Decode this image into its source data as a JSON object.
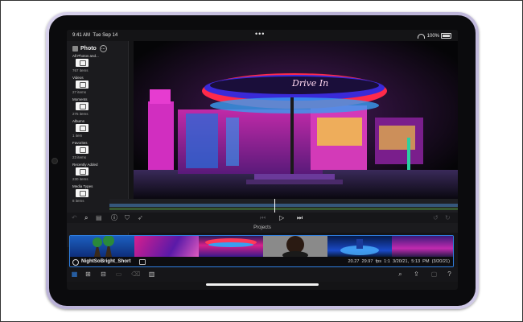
{
  "status_bar": {
    "time": "9:41 AM",
    "date": "Tue Sep 14",
    "battery": "100%"
  },
  "sidebar": {
    "title": "Photo",
    "items": [
      {
        "name": "All Photos and...",
        "count": "767 items"
      },
      {
        "name": "Videos",
        "count": "27 items"
      },
      {
        "name": "Moments",
        "count": "275 items"
      },
      {
        "name": "Albums",
        "count": "1 item"
      },
      {
        "name": "Favorites",
        "count": "23 items"
      },
      {
        "name": "Recently Added",
        "count": "230 items"
      },
      {
        "name": "Media Types",
        "count": "8 items"
      }
    ]
  },
  "viewer": {
    "neon_sign_text": "Drive In"
  },
  "projects": {
    "label": "Projects",
    "project_name": "NightSoBright_Short",
    "duration": "20.27",
    "fps": "29.97 fps",
    "aspect": "1:1",
    "date_range": "3/20/21, 5:13 PM",
    "date_short": "(3/20/21)"
  },
  "colors": {
    "accent": "#2f7fe0",
    "screen_bg": "#141416",
    "device": "#c9c2e2"
  },
  "icons": {
    "controls": [
      "undo-icon",
      "search-icon",
      "library-icon",
      "info-icon",
      "shield-icon",
      "magic-icon",
      "skip-back-icon",
      "play-icon",
      "skip-forward-icon",
      "undo-arrow-icon",
      "redo-arrow-icon"
    ],
    "toolbar": [
      "media-library-icon",
      "import-icon",
      "export-icon",
      "clip-icon",
      "trash-icon",
      "stack-icon",
      "search-icon",
      "share-icon",
      "document-icon",
      "help-icon"
    ]
  }
}
